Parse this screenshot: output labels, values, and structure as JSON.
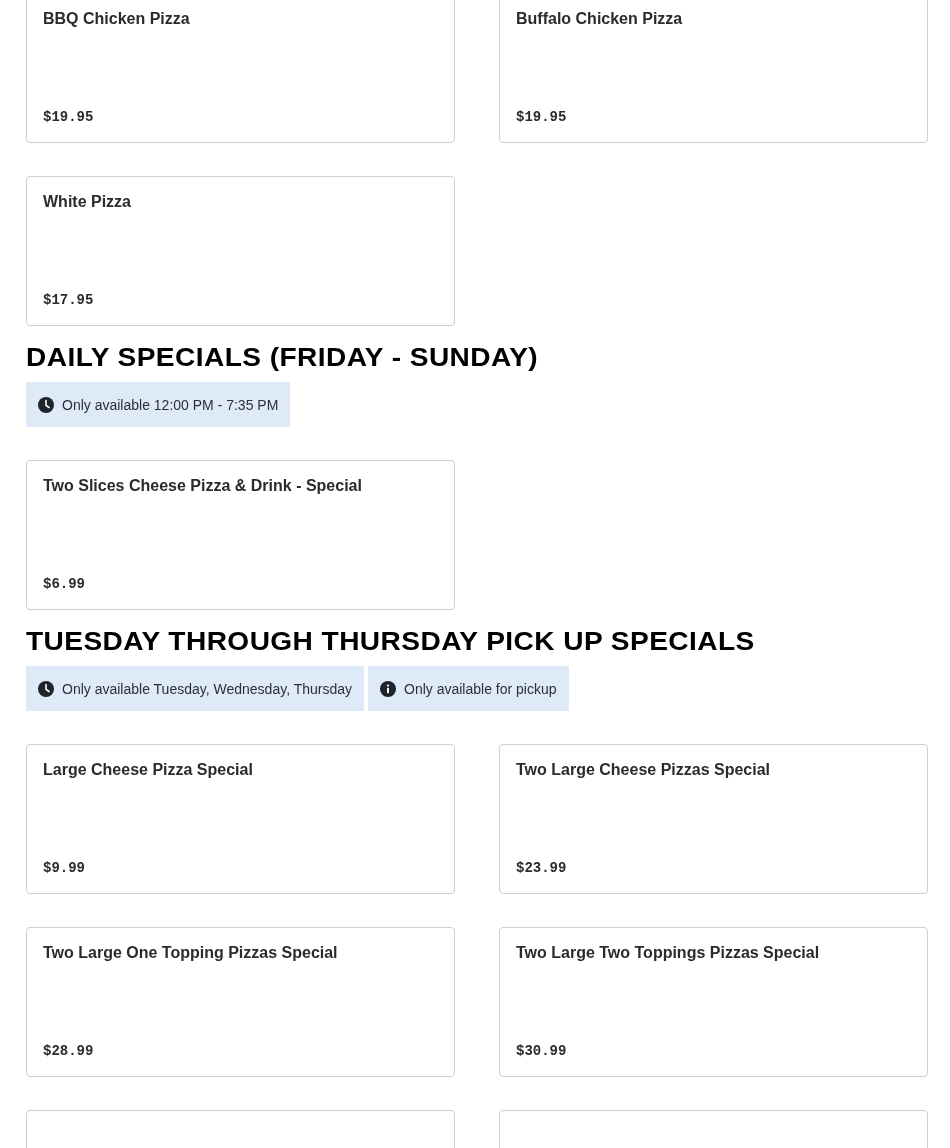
{
  "sections": [
    {
      "items": [
        {
          "kind": "item",
          "name": "BBQ Chicken Pizza",
          "price": "$19.95"
        },
        {
          "kind": "item",
          "name": "Buffalo Chicken Pizza",
          "price": "$19.95"
        },
        {
          "kind": "item",
          "name": "White Pizza",
          "price": "$17.95"
        }
      ]
    },
    {
      "heading": "DAILY SPECIALS (FRIDAY - SUNDAY)",
      "notices": [
        {
          "kind": "time",
          "text": "Only available 12:00 PM - 7:35 PM"
        }
      ],
      "items": [
        {
          "kind": "item",
          "name": "Two Slices Cheese Pizza & Drink - Special",
          "price": "$6.99"
        }
      ]
    },
    {
      "heading": "TUESDAY THROUGH THURSDAY PICK UP SPECIALS",
      "notices": [
        {
          "kind": "time",
          "text": "Only available Tuesday, Wednesday, Thursday"
        },
        {
          "kind": "info",
          "text": "Only available for pickup"
        }
      ],
      "items": [
        {
          "kind": "item",
          "name": "Large Cheese Pizza Special",
          "price": "$9.99"
        },
        {
          "kind": "item",
          "name": "Two Large Cheese Pizzas Special",
          "price": "$23.99"
        },
        {
          "kind": "item",
          "name": "Two Large One Topping Pizzas Special",
          "price": "$28.99"
        },
        {
          "kind": "item",
          "name": "Two Large Two Toppings Pizzas Special",
          "price": "$30.99"
        },
        {
          "kind": "cut-off"
        },
        {
          "kind": "cut-off"
        }
      ]
    }
  ]
}
